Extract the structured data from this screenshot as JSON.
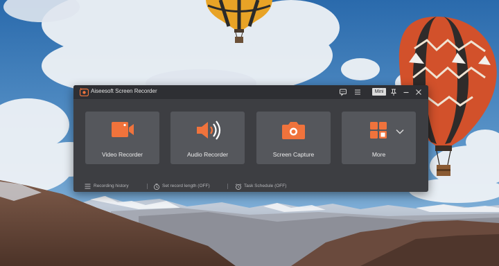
{
  "app": {
    "title": "Aiseesoft Screen Recorder",
    "accent_color": "#f0733c",
    "titlebar_buttons": [
      {
        "name": "feedback",
        "icon": "feedback-icon"
      },
      {
        "name": "menu",
        "icon": "menu-icon"
      },
      {
        "name": "mini",
        "label": "Mini"
      },
      {
        "name": "pin",
        "icon": "pin-icon"
      },
      {
        "name": "minimize",
        "icon": "minimize-icon"
      },
      {
        "name": "close",
        "icon": "close-icon"
      }
    ]
  },
  "tiles": [
    {
      "label": "Video Recorder",
      "icon": "video-camera-icon"
    },
    {
      "label": "Audio Recorder",
      "icon": "speaker-icon"
    },
    {
      "label": "Screen Capture",
      "icon": "camera-icon"
    },
    {
      "label": "More",
      "icon": "grid-icon",
      "extra_icon": "chevron-down-icon"
    }
  ],
  "status_bar": {
    "history": {
      "label": "Recording history",
      "icon": "list-icon"
    },
    "record_length": {
      "label": "Set record length (OFF)",
      "icon": "timer-icon"
    },
    "task_schedule": {
      "label": "Task Schedule (OFF)",
      "icon": "alarm-clock-icon"
    }
  }
}
